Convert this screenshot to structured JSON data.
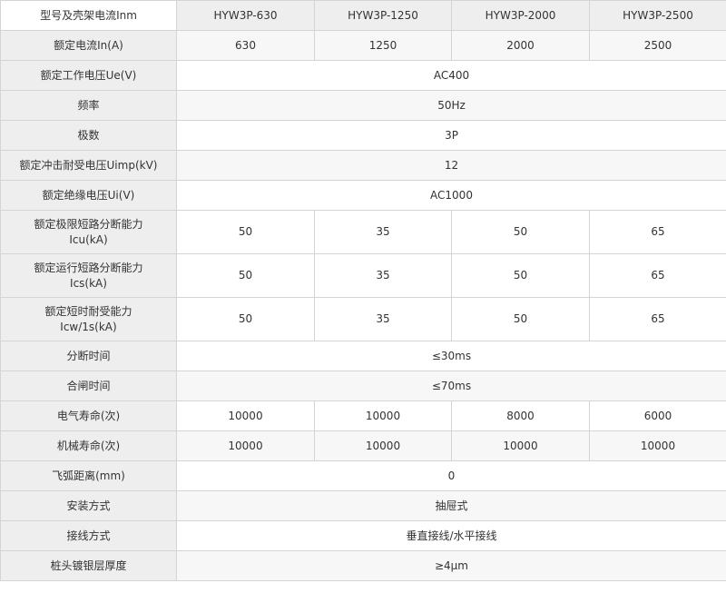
{
  "table": {
    "header_label": "型号及壳架电流Inm",
    "models": [
      "HYW3P-630",
      "HYW3P-1250",
      "HYW3P-2000",
      "HYW3P-2500"
    ],
    "rows": [
      {
        "label": "额定电流In(A)",
        "values": [
          "630",
          "1250",
          "2000",
          "2500"
        ]
      },
      {
        "label": "额定工作电压Ue(V)",
        "value": "AC400"
      },
      {
        "label": "频率",
        "value": "50Hz"
      },
      {
        "label": "极数",
        "value": "3P"
      },
      {
        "label": "额定冲击耐受电压Uimp(kV)",
        "value": "12"
      },
      {
        "label": "额定绝缘电压Ui(V)",
        "value": "AC1000"
      },
      {
        "label_line1": "额定极限短路分断能力",
        "label_line2": "Icu(kA)",
        "values": [
          "50",
          "35",
          "50",
          "65"
        ]
      },
      {
        "label_line1": "额定运行短路分断能力",
        "label_line2": "Ics(kA)",
        "values": [
          "50",
          "35",
          "50",
          "65"
        ]
      },
      {
        "label_line1": "额定短时耐受能力",
        "label_line2": "Icw/1s(kA)",
        "values": [
          "50",
          "35",
          "50",
          "65"
        ]
      },
      {
        "label": "分断时间",
        "value": "≤30ms"
      },
      {
        "label": "合闸时间",
        "value": "≤70ms"
      },
      {
        "label": "电气寿命(次)",
        "values": [
          "10000",
          "10000",
          "8000",
          "6000"
        ]
      },
      {
        "label": "机械寿命(次)",
        "values": [
          "10000",
          "10000",
          "10000",
          "10000"
        ]
      },
      {
        "label": "飞弧距离(mm)",
        "value": "0"
      },
      {
        "label": "安装方式",
        "value": "抽屉式"
      },
      {
        "label": "接线方式",
        "value": "垂直接线/水平接线"
      },
      {
        "label": "桩头镀银层厚度",
        "value": "≥4μm"
      }
    ]
  }
}
